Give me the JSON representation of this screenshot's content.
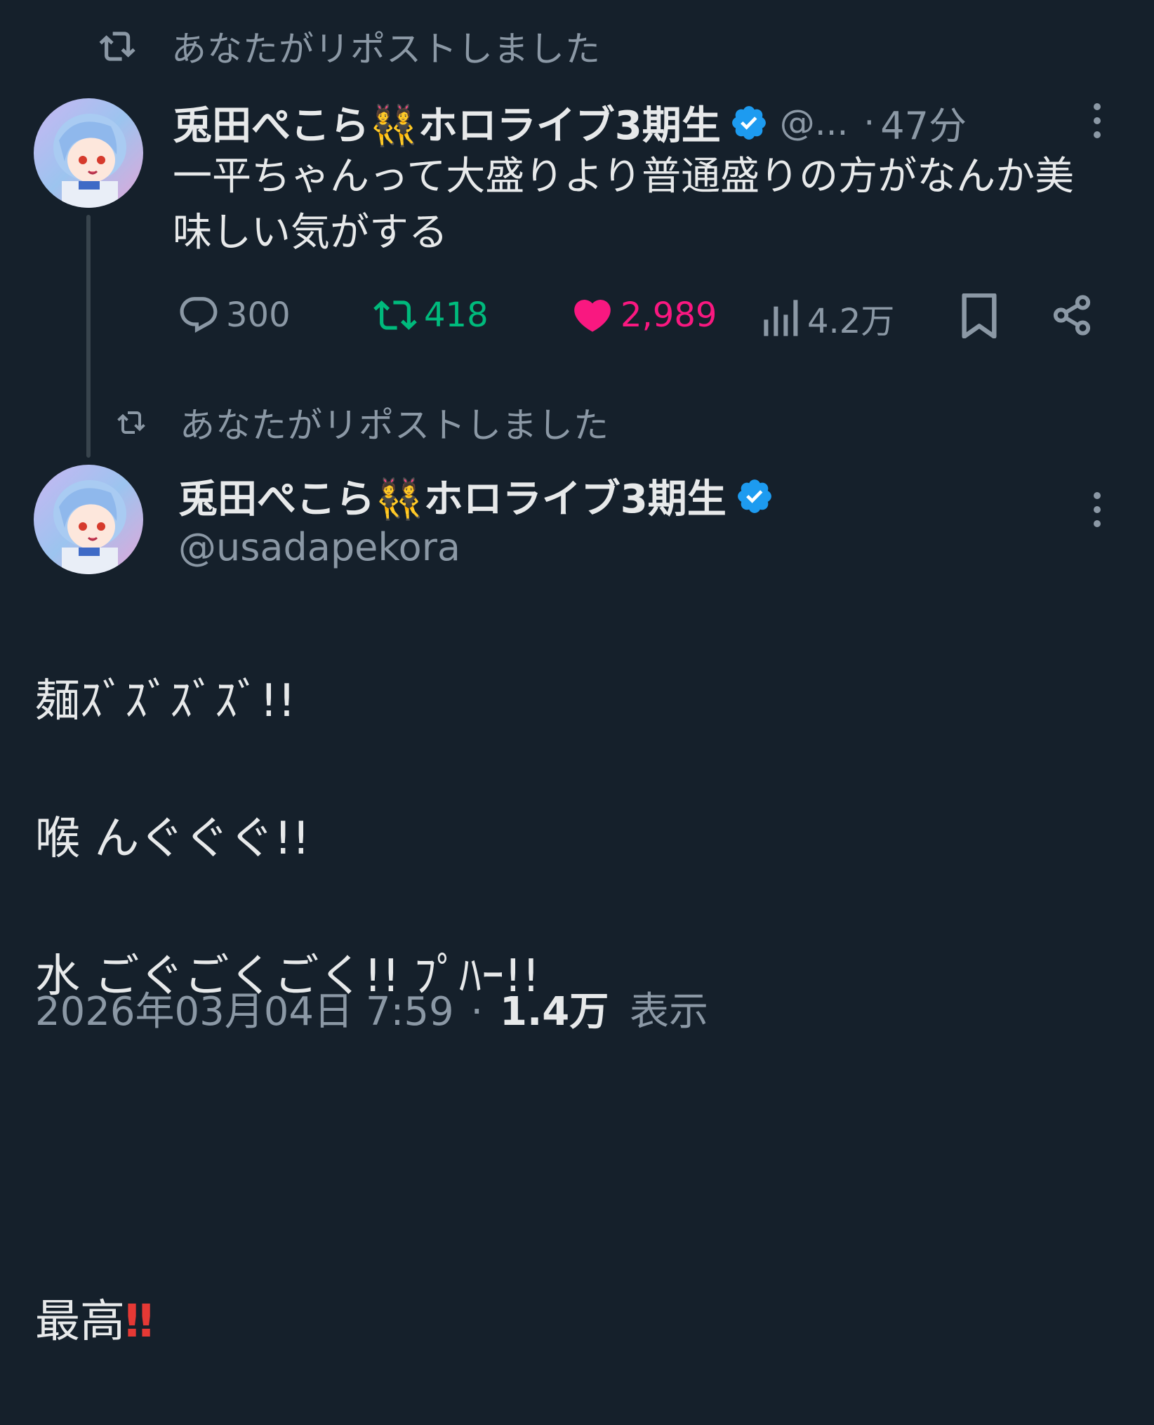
{
  "repost_banner_1": {
    "icon": "repost-icon",
    "text": "あなたがリポストしました"
  },
  "reply_tweet": {
    "display_name": "兎田ぺこら👯ホロライブ3期生",
    "verified_icon": "verified-badge-icon",
    "handle": "@...",
    "separator": "·",
    "time": "47分",
    "text": "一平ちゃんって大盛りより普通盛りの方がなんか美味しい気がする",
    "stats": {
      "replies": "300",
      "reposts": "418",
      "likes": "2,989",
      "views": "4.2万"
    },
    "colors": {
      "repost_active": "#00ba7c",
      "like_active": "#f91880",
      "verified": "#1d9bf0"
    }
  },
  "repost_banner_2": {
    "icon": "repost-icon",
    "text": "あなたがリポストしました"
  },
  "main_tweet": {
    "display_name": "兎田ぺこら👯ホロライブ3期生",
    "handle": "@usadapekora",
    "text_line1": "麺ｽﾞｽﾞｽﾞｽﾞ!!",
    "text_line2": "喉 んぐぐぐ!!",
    "text_line3": "水 ごぐごくごく!! ﾌﾟﾊｰ!!",
    "text_line4": "最高",
    "text_emoji": "‼",
    "date_time": "2026年03月04日 7:59",
    "separator": "·",
    "views_count": "1.4万",
    "views_label": "表示"
  }
}
